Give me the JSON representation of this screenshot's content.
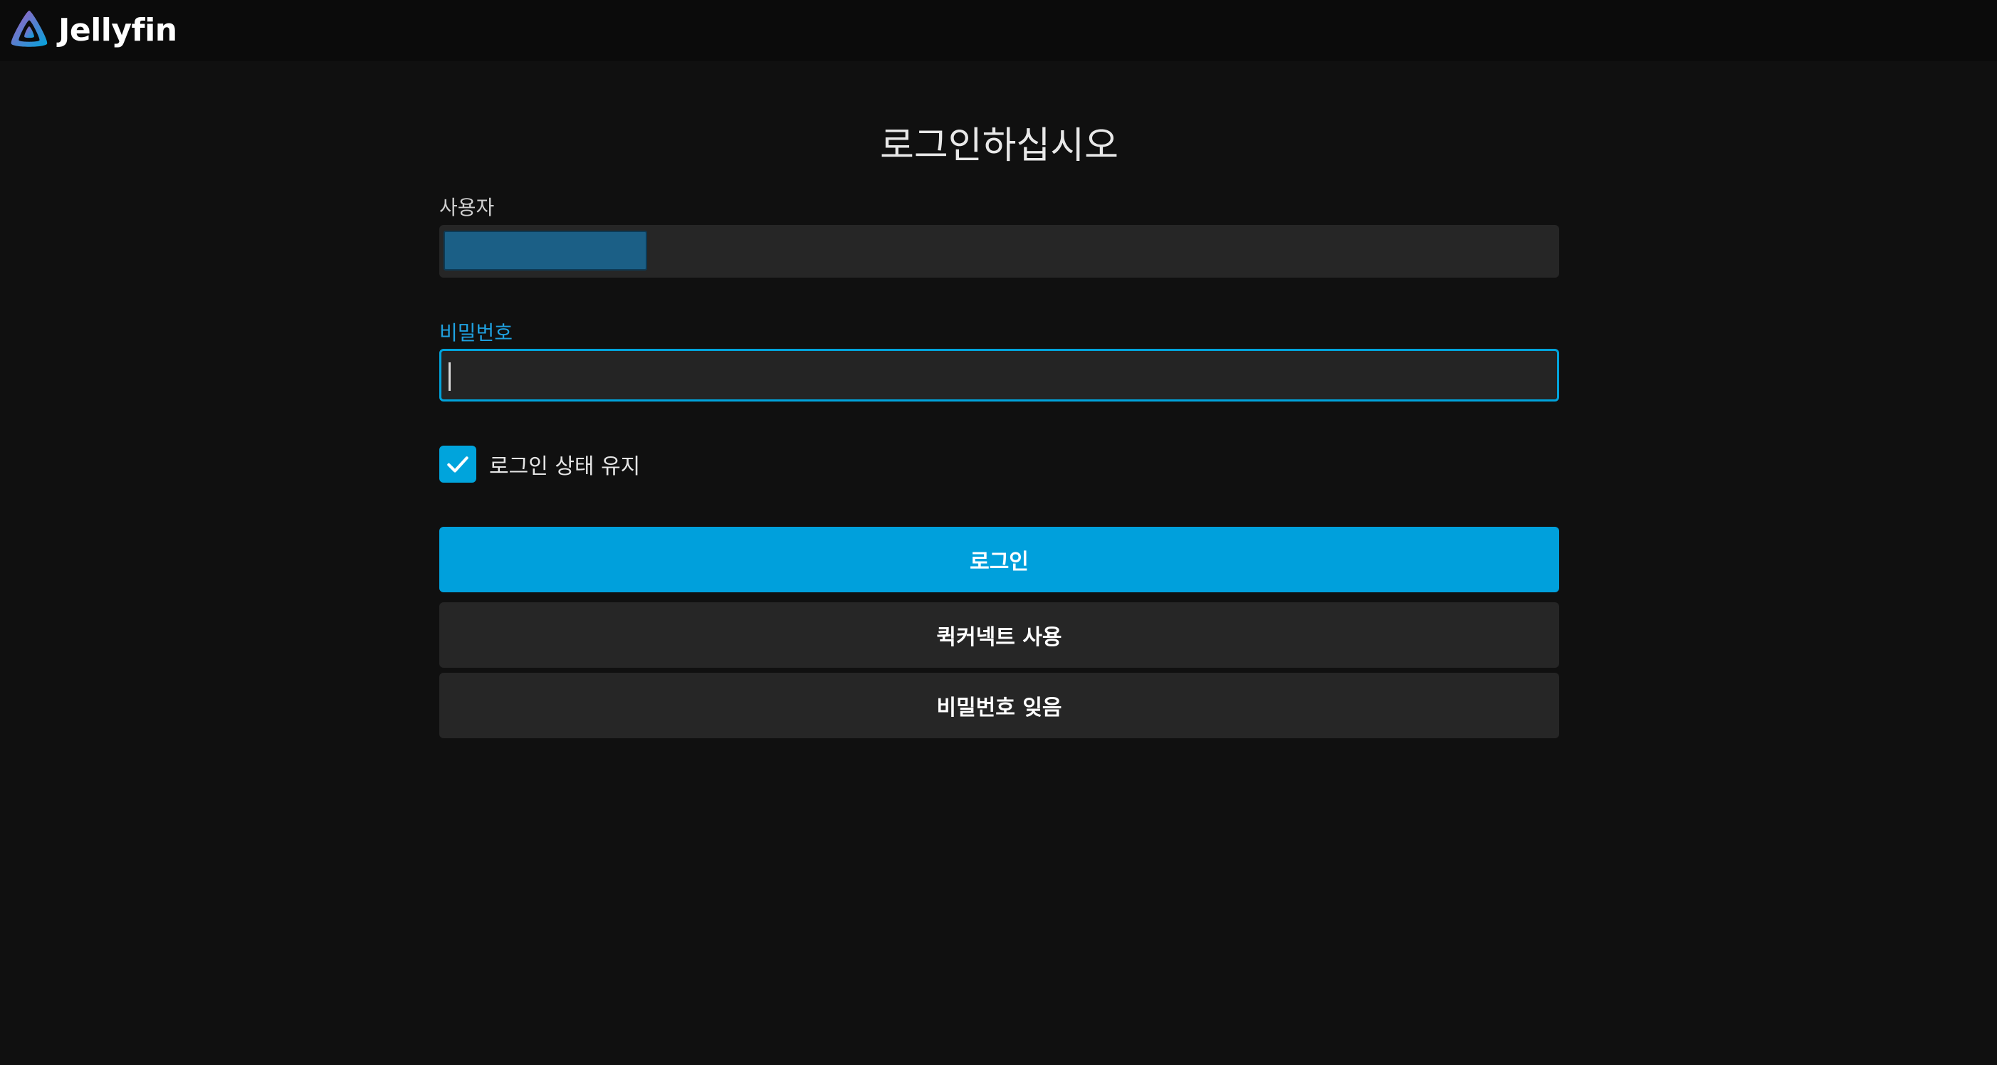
{
  "app": {
    "brand_name": "Jellyfin",
    "logo_icon": "jellyfin-logo-icon"
  },
  "login": {
    "title": "로그인하십시오",
    "username_label": "사용자",
    "username_value": "",
    "password_label": "비밀번호",
    "password_value": "",
    "remember_label": "로그인 상태 유지",
    "remember_checked": true,
    "login_button": "로그인",
    "quick_connect_button": "퀵커넥트 사용",
    "forgot_password_button": "비밀번호 잊음"
  },
  "colors": {
    "accent": "#00a4dc",
    "background": "#101010",
    "input_background": "#262626",
    "logo_gradient_start": "#aa5cc3",
    "logo_gradient_end": "#00a4dc"
  }
}
